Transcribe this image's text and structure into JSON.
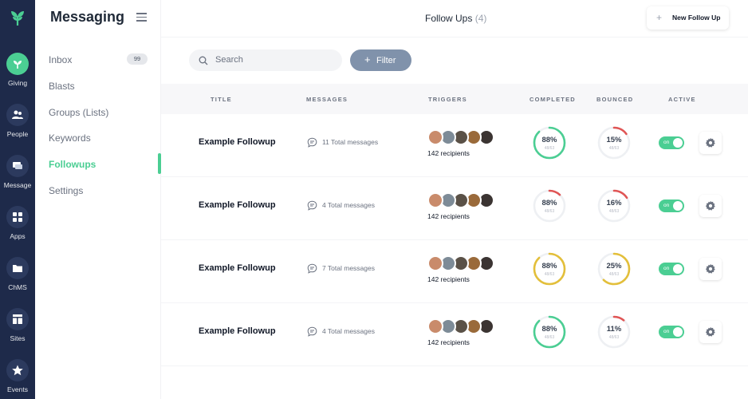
{
  "rail": {
    "items": [
      {
        "label": "Giving",
        "icon": "leaf-icon",
        "active": true
      },
      {
        "label": "People",
        "icon": "people-icon"
      },
      {
        "label": "Message",
        "icon": "message-icon"
      },
      {
        "label": "Apps",
        "icon": "apps-icon"
      },
      {
        "label": "ChMS",
        "icon": "folder-icon"
      },
      {
        "label": "Sites",
        "icon": "sites-icon"
      },
      {
        "label": "Events",
        "icon": "star-icon"
      }
    ]
  },
  "sidebar": {
    "title": "Messaging",
    "items": [
      {
        "label": "Inbox",
        "badge": "99"
      },
      {
        "label": "Blasts"
      },
      {
        "label": "Groups (Lists)"
      },
      {
        "label": "Keywords"
      },
      {
        "label": "Followups",
        "active": true
      },
      {
        "label": "Settings"
      }
    ]
  },
  "header": {
    "title": "Follow Ups",
    "count": "(4)",
    "new_button": "New Follow Up"
  },
  "toolbar": {
    "search_placeholder": "Search",
    "filter_label": "Filter"
  },
  "table": {
    "columns": [
      "TITLE",
      "MESSAGES",
      "TRIGGERS",
      "COMPLETED",
      "BOUNCED",
      "ACTIVE"
    ],
    "rows": [
      {
        "title": "Example Followup",
        "messages": "11 Total messages",
        "recipients": "142 recipients",
        "completed": {
          "pct": "88%",
          "sub": "48/63",
          "value": 0.88,
          "color": "#4bce93"
        },
        "bounced": {
          "pct": "15%",
          "sub": "48/63",
          "value": 0.15,
          "color": "#e05555"
        },
        "toggle": "on"
      },
      {
        "title": "Example Followup",
        "messages": "4 Total messages",
        "recipients": "142 recipients",
        "completed": {
          "pct": "88%",
          "sub": "48/63",
          "value": 0.12,
          "color": "#e05555"
        },
        "bounced": {
          "pct": "16%",
          "sub": "48/63",
          "value": 0.16,
          "color": "#e05555"
        },
        "toggle": "on"
      },
      {
        "title": "Example Followup",
        "messages": "7 Total messages",
        "recipients": "142 recipients",
        "completed": {
          "pct": "88%",
          "sub": "48/63",
          "value": 0.88,
          "color": "#e3bf3a"
        },
        "bounced": {
          "pct": "25%",
          "sub": "48/63",
          "value": 0.62,
          "color": "#e3bf3a"
        },
        "toggle": "on"
      },
      {
        "title": "Example Followup",
        "messages": "4 Total messages",
        "recipients": "142 recipients",
        "completed": {
          "pct": "88%",
          "sub": "48/63",
          "value": 0.88,
          "color": "#4bce93"
        },
        "bounced": {
          "pct": "11%",
          "sub": "48/63",
          "value": 0.11,
          "color": "#e05555"
        },
        "toggle": "on"
      }
    ]
  },
  "colors": {
    "rail_bg": "#1e2a4a",
    "accent": "#4bce93",
    "danger": "#e05555",
    "warning": "#e3bf3a",
    "filter_bg": "#8092ab"
  }
}
